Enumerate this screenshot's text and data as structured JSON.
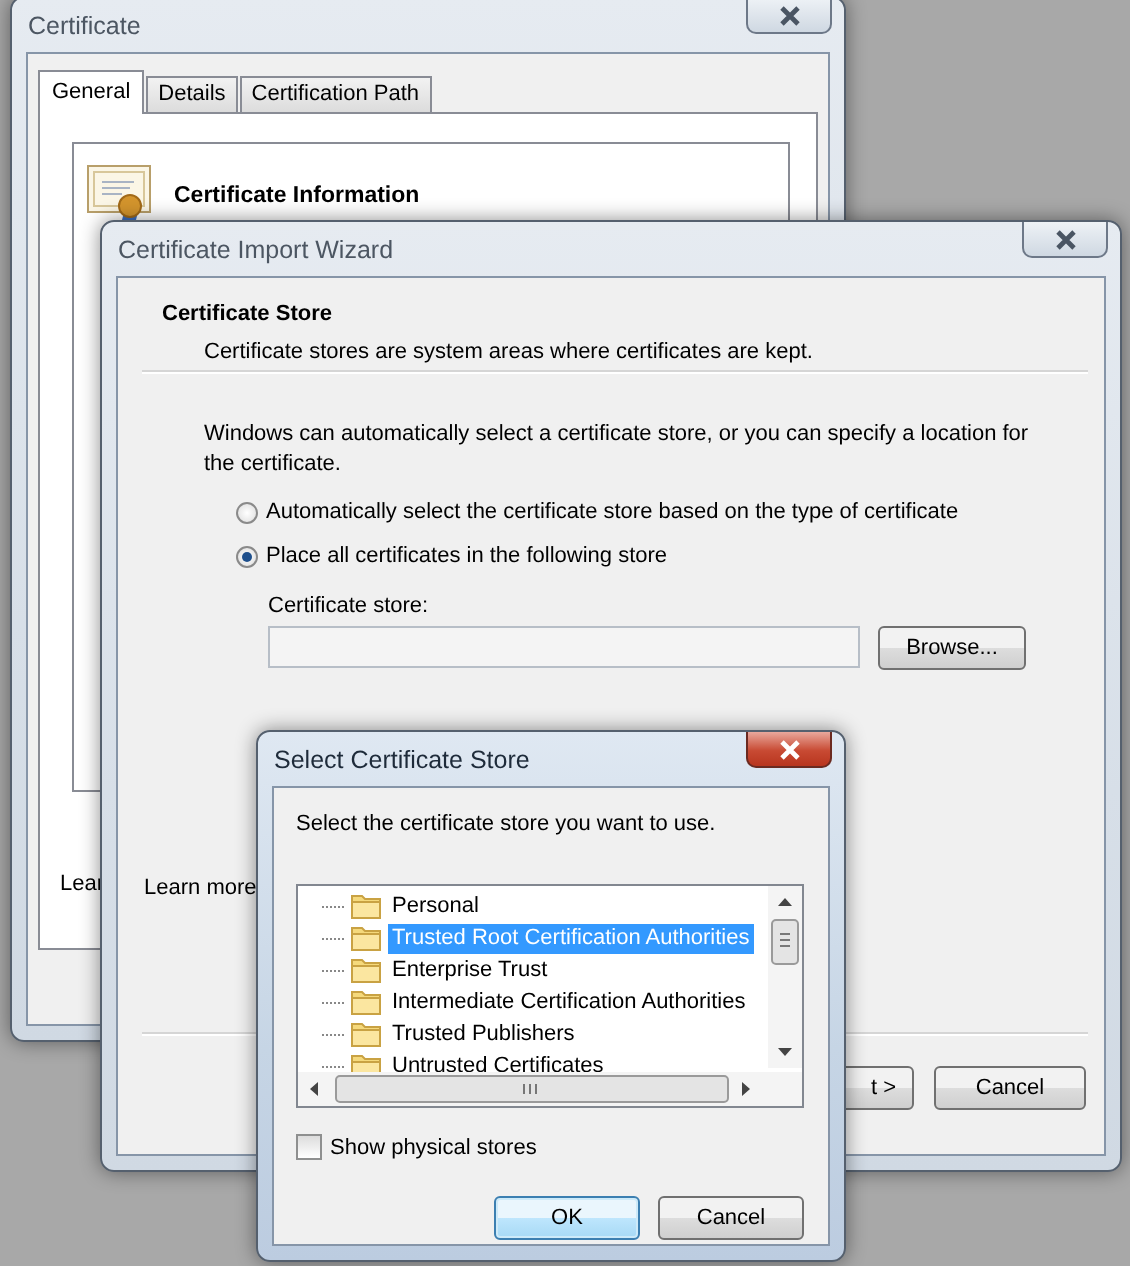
{
  "windows": [
    {
      "kind": "properties",
      "title": "Certificate",
      "active": false,
      "tabs": [
        {
          "label": "General",
          "selected": true
        },
        {
          "label": "Details",
          "selected": false
        },
        {
          "label": "Certification Path",
          "selected": false
        }
      ],
      "heading": "Certificate Information",
      "link": "Lear"
    },
    {
      "kind": "wizard",
      "title": "Certificate Import Wizard",
      "active": false,
      "header": {
        "title": "Certificate Store",
        "subtitle": "Certificate stores are system areas where certificates are kept."
      },
      "description": "Windows can automatically select a certificate store, or you can specify a location for the certificate.",
      "options": [
        {
          "label": "Automatically select the certificate store based on the type of certificate",
          "selected": false
        },
        {
          "label": "Place all certificates in the following store",
          "selected": true
        }
      ],
      "store_field": {
        "label": "Certificate store:"
      },
      "browse_button": "Browse...",
      "link": "Learn more",
      "buttons": [
        {
          "label": "t >",
          "default": false
        },
        {
          "label": "Cancel",
          "default": false
        }
      ]
    },
    {
      "kind": "dialog",
      "title": "Select Certificate Store",
      "active": true,
      "prompt": "Select the certificate store you want to use.",
      "stores": [
        {
          "label": "Personal",
          "selected": false
        },
        {
          "label": "Trusted Root Certification Authorities",
          "selected": true
        },
        {
          "label": "Enterprise Trust",
          "selected": false
        },
        {
          "label": "Intermediate Certification Authorities",
          "selected": false
        },
        {
          "label": "Trusted Publishers",
          "selected": false
        },
        {
          "label": "Untrusted Certificates",
          "selected": false
        }
      ],
      "show_physical": {
        "label": "Show physical stores",
        "checked": false
      },
      "buttons": [
        {
          "label": "OK",
          "default": true
        },
        {
          "label": "Cancel",
          "default": false
        }
      ]
    }
  ]
}
